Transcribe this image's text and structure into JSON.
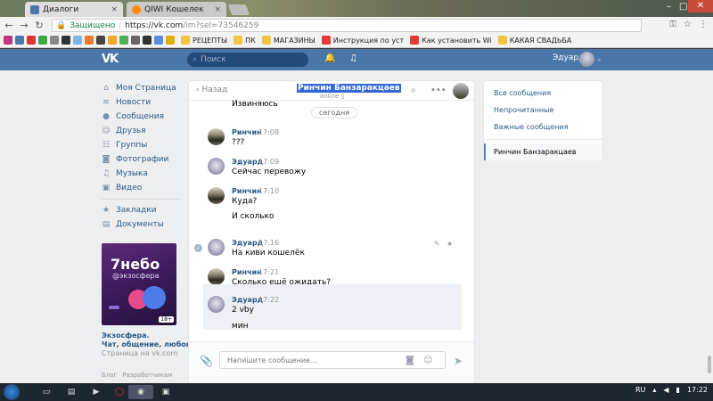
{
  "browser": {
    "tabs": [
      {
        "label": "Диалоги",
        "favicon_color": "#4a76a8"
      },
      {
        "label": "QIWI Кошелек",
        "favicon_color": "#ff8c00"
      }
    ],
    "secure_label": "Защищено",
    "url_main": "https://vk.com",
    "url_rest": "/im?sel=73546259",
    "bookmarks": [
      "РЕЦЕПТЫ",
      "ПК",
      "МАГАЗИНЫ",
      "Инструкция по уст",
      "Как установить Wi",
      "КАКАЯ СВАДЬБА"
    ]
  },
  "vk": {
    "logo": "VK",
    "search_placeholder": "Поиск",
    "user_name": "Эдуард",
    "brand_color": "#4a76a8"
  },
  "nav": {
    "items": [
      {
        "icon": "⌂",
        "label": "Моя Страница"
      },
      {
        "icon": "≡",
        "label": "Новости"
      },
      {
        "icon": "●",
        "label": "Сообщения"
      },
      {
        "icon": "☺",
        "label": "Друзья"
      },
      {
        "icon": "☷",
        "label": "Группы"
      },
      {
        "icon": "◙",
        "label": "Фотографии"
      },
      {
        "icon": "♫",
        "label": "Музыка"
      },
      {
        "icon": "▣",
        "label": "Видео"
      }
    ],
    "extra": [
      {
        "icon": "★",
        "label": "Закладки"
      },
      {
        "icon": "▤",
        "label": "Документы"
      }
    ]
  },
  "ad": {
    "title": "7небо",
    "subtitle": "@экзосфера",
    "age": "18+",
    "name": "Экзосфера.",
    "tagline": "Чат, общение, любовь.",
    "source": "Страница на vk.com"
  },
  "footer": [
    "Блог",
    "Разработчикам"
  ],
  "chat": {
    "peer_name": "Ринчин Банзаракцаев",
    "peer_status": "online",
    "back_label": "Назад",
    "date_chip": "сегодня",
    "top_text": "Извиняюсь",
    "messages": [
      {
        "author": "Ринчин",
        "time": "17:08",
        "lines": [
          "???"
        ]
      },
      {
        "author": "Эдуард",
        "time": "17:09",
        "lines": [
          "Сейчас перевожу"
        ]
      },
      {
        "author": "Ринчин",
        "time": "17:10",
        "lines": [
          "Куда?",
          "И сколько"
        ]
      },
      {
        "author": "Эдуард",
        "time": "17:16",
        "lines": [
          "На киви кошелёк"
        ]
      },
      {
        "author": "Ринчин",
        "time": "17:21",
        "lines": [
          "Сколько ещё ожидать?"
        ]
      },
      {
        "author": "Эдуард",
        "time": "17:22",
        "lines": [
          "2 vby",
          "мин"
        ]
      }
    ],
    "compose_placeholder": "Напишите сообщение..."
  },
  "folders": {
    "items": [
      "Все сообщения",
      "Непрочитанные",
      "Важные сообщения"
    ],
    "active": "Ринчин Банзаракцаев"
  },
  "taskbar": {
    "lang": "RU",
    "time": "17:22"
  }
}
